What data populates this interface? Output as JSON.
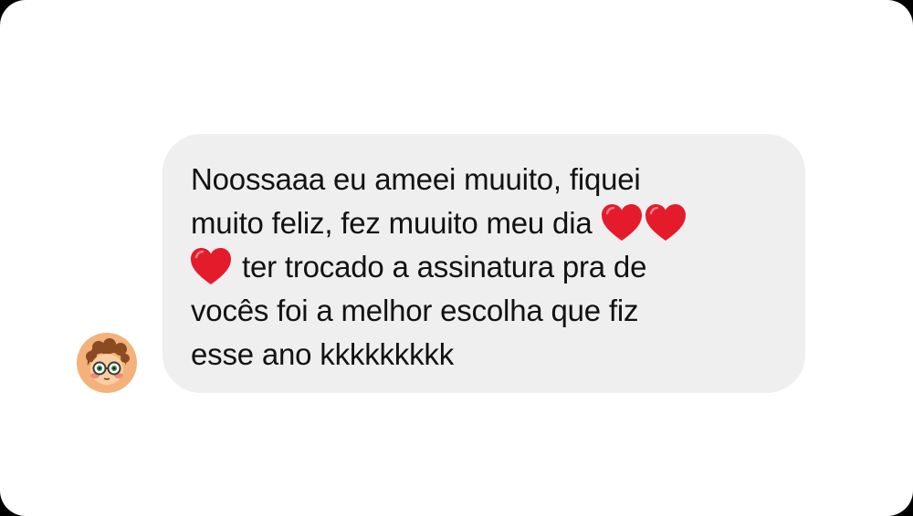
{
  "message": {
    "line1": "Noossaaa eu ameei muuito, fiquei",
    "line2_text": "muito feliz, fez muuito meu dia",
    "line3_text": "ter trocado a assinatura pra de",
    "line4": "vocês foi a melhor escolha que fiz",
    "line5": "esse ano kkkkkkkkk",
    "emoji": "red-heart-icon"
  },
  "colors": {
    "card_background": "#ffffff",
    "bubble_background": "#efefef",
    "text": "#121212",
    "heart": "#e31b2b",
    "avatar_background": "#f4b27a"
  }
}
